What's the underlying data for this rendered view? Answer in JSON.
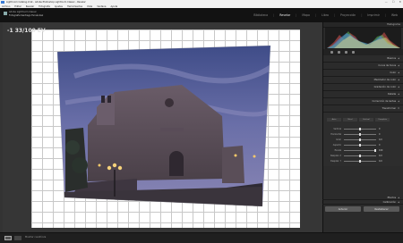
{
  "window": {
    "title": "Lightroom Catalog.lrcat - Adobe Photoshop Lightroom Classic - Revelar",
    "controls": [
      "—",
      "☐",
      "✕"
    ]
  },
  "menu": [
    "Archivo",
    "Editar",
    "Revelar",
    "Fotografía",
    "Ajustes",
    "Herramientas",
    "Vista",
    "Ventana",
    "Ayuda"
  ],
  "identity": {
    "line1": "Adobe Lightroom Classic",
    "line2": "Fotografía Santiago Fernández"
  },
  "modules": {
    "items": [
      "Biblioteca",
      "Revelar",
      "Mapa",
      "Libro",
      "Proyección",
      "Imprimir",
      "Web"
    ],
    "active": "Revelar"
  },
  "readout": "-1 33/100 EV",
  "right_panel": {
    "histogram_label": "Histograma",
    "sections": [
      "Básicos",
      "Curva de tonos",
      "Color",
      "Mezclador de color",
      "Gradación de color",
      "Detalle",
      "Corrección de lentes",
      "Transformar"
    ],
    "transform_buttons": [
      "Auto",
      "Nivel",
      "Vertical",
      "Completa"
    ],
    "transform_sliders": [
      {
        "label": "Vertical",
        "value": "0"
      },
      {
        "label": "Horizontal",
        "value": "0"
      },
      {
        "label": "Girar",
        "value": "0,0"
      },
      {
        "label": "Aspecto",
        "value": "0"
      },
      {
        "label": "Escala",
        "value": "100"
      },
      {
        "label": "Desplaz. X",
        "value": "0,0"
      },
      {
        "label": "Desplaz. Y",
        "value": "0,0"
      }
    ],
    "lower_sections": [
      "Efectos",
      "Calibración"
    ],
    "previous_button": "Anterior",
    "reset_button": "Restablecer"
  },
  "toolbar": {
    "label": "Mostrar cuadrícula"
  },
  "colors": {
    "accent_active": "#f0f0f0",
    "histogram_red": "#d9534f",
    "histogram_green": "#5cb85c",
    "histogram_blue": "#4a90e2"
  }
}
